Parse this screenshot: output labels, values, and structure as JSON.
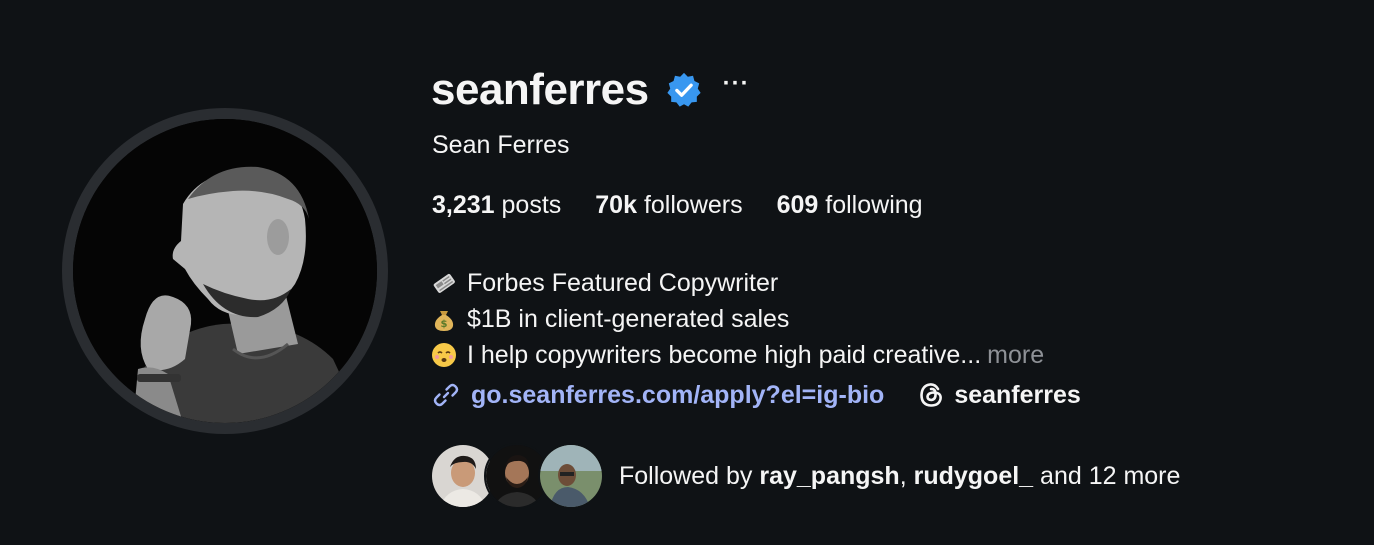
{
  "profile": {
    "username": "seanferres",
    "full_name": "Sean Ferres",
    "verified": true,
    "stats": {
      "posts_count": "3,231",
      "posts_label": "posts",
      "followers_count": "70k",
      "followers_label": "followers",
      "following_count": "609",
      "following_label": "following"
    },
    "bio": {
      "lines": [
        {
          "icon": "newspaper-emoji",
          "text": "Forbes Featured Copywriter"
        },
        {
          "icon": "money-bag-emoji",
          "text": "$1B in client-generated sales"
        },
        {
          "icon": "face-exhaling-emoji",
          "text": "I help copywriters become high paid creative..."
        }
      ],
      "more_label": "more"
    },
    "website": "go.seanferres.com/apply?el=ig-bio",
    "threads_handle": "seanferres",
    "followed_by": {
      "prefix": "Followed by",
      "user1": "ray_pangsh",
      "separator": ",",
      "user2": "rudygoel_",
      "suffix": "and 12 more"
    }
  },
  "colors": {
    "background": "#0f1215",
    "text": "#f5f5f5",
    "link": "#a2b4f7",
    "verified": "#3897f0",
    "muted": "#8e9196"
  },
  "icons": [
    "verified-badge-icon",
    "more-options-icon",
    "link-icon",
    "threads-icon"
  ]
}
